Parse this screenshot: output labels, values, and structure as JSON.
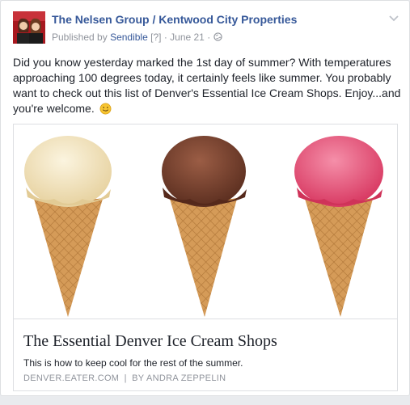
{
  "post": {
    "page_name": "The Nelsen Group / Kentwood City Properties",
    "published_by_label": "Published by",
    "publisher": "Sendible",
    "help_marker": "[?]",
    "separator": "·",
    "date": "June 21",
    "audience_icon": "globe-icon",
    "menu_icon": "chevron-down-icon",
    "text": "Did you know yesterday marked the 1st day of summer? With temperatures approaching 100 degrees today, it certainly feels like summer. You probably want to check out this list of Denver's Essential Ice Cream Shops. Enjoy...and you're welcome.",
    "emoji": "smile-emoji"
  },
  "link_card": {
    "image_description_icons": [
      "vanilla-ice-cream-cone",
      "chocolate-ice-cream-cone",
      "strawberry-ice-cream-cone"
    ],
    "title": "The Essential Denver Ice Cream Shops",
    "description": "This is how to keep cool for the rest of the summer.",
    "domain": "DENVER.EATER.COM",
    "byline_separator": "|",
    "byline": "BY ANDRA ZEPPELIN"
  },
  "colors": {
    "link_blue": "#365899",
    "meta_gray": "#90949c",
    "text": "#1d2129",
    "avatar_red": "#b21e24",
    "vanilla": "#f3e6c4",
    "chocolate": "#7a4634",
    "strawberry": "#e8537a",
    "cone": "#d9a15b"
  }
}
